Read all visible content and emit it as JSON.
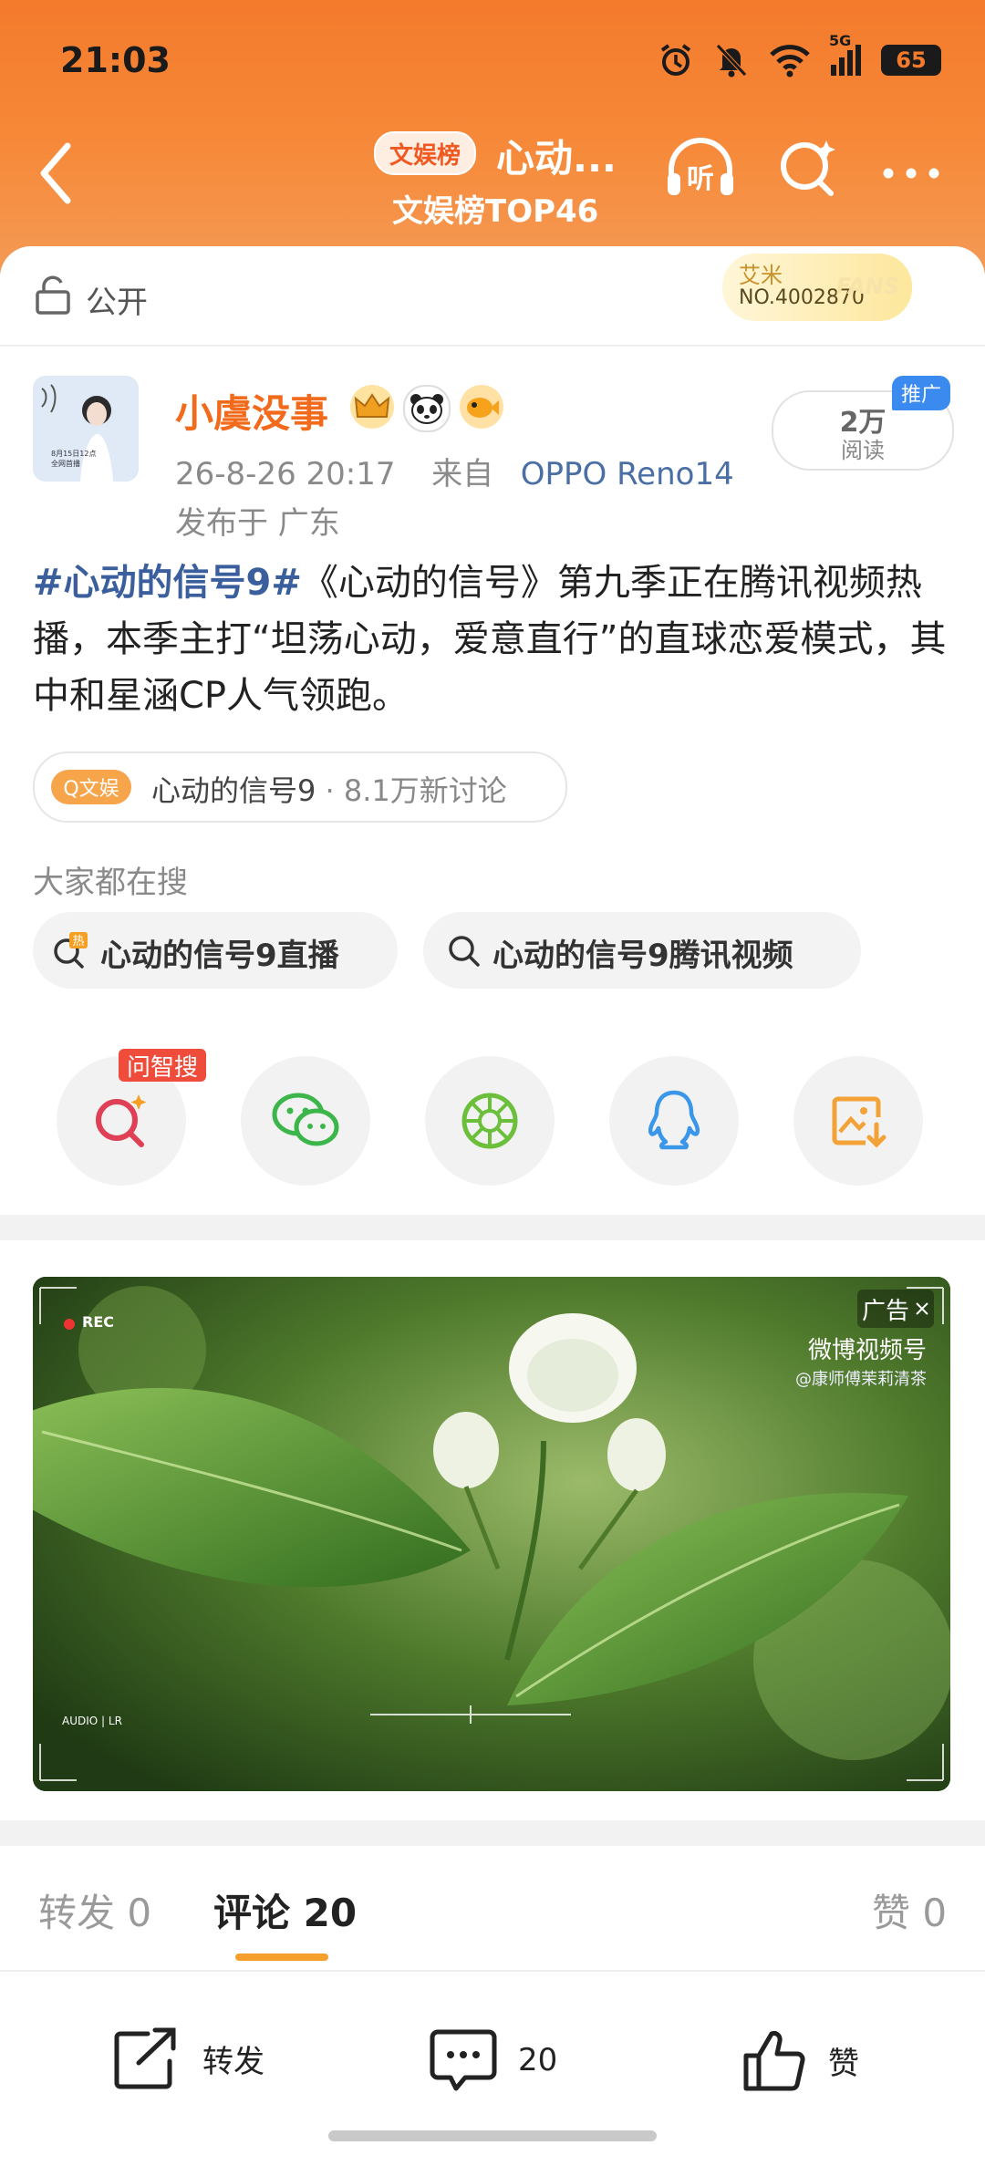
{
  "status_bar": {
    "time": "21:03",
    "network": "5G",
    "battery": "65"
  },
  "nav": {
    "topic_badge": "文娱榜",
    "title": "心动...",
    "rank": "文娱榜TOP46"
  },
  "visibility": {
    "label": "公开"
  },
  "fans_badge": {
    "name": "艾米",
    "number": "NO.4002870",
    "word": "FANS"
  },
  "post": {
    "username": "小虞没事",
    "time": "26-8-26 20:17",
    "from_prefix": "来自",
    "device": "OPPO Reno14",
    "location": "发布于 广东",
    "reads_count": "2万",
    "reads_label": "阅读",
    "promo_label": "推广",
    "hashtag": "#心动的信号9#",
    "body": "《心动的信号》第九季正在腾讯视频热播，本季主打“坦荡心动，爱意直行”的直球恋爱模式，其中和星涵CP人气领跑。",
    "avatar_text_line1": "8月15日12点",
    "avatar_text_line2": "全网首播"
  },
  "topic_pill": {
    "tag": "Q文娱",
    "name": "心动的信号9",
    "count": " · 8.1万新讨论"
  },
  "search": {
    "heading": "大家都在搜",
    "chips": [
      "心动的信号9直播",
      "心动的信号9腾讯视频"
    ]
  },
  "share": {
    "ask_badge": "问智搜"
  },
  "ad": {
    "label": "广告",
    "source": "微博视频号",
    "account": "@康师傅茉莉清茶",
    "rec": "REC",
    "audio": "AUDIO | LR"
  },
  "tabs": {
    "repost": "转发 0",
    "comment": "评论 20",
    "like": "赞 0"
  },
  "actions": {
    "repost_label": "转发",
    "comment_count": "20",
    "like_label": "赞"
  },
  "colors": {
    "brand_orange": "#f47a2c",
    "link_blue": "#3a5f9c",
    "username_orange": "#f26a1b"
  }
}
